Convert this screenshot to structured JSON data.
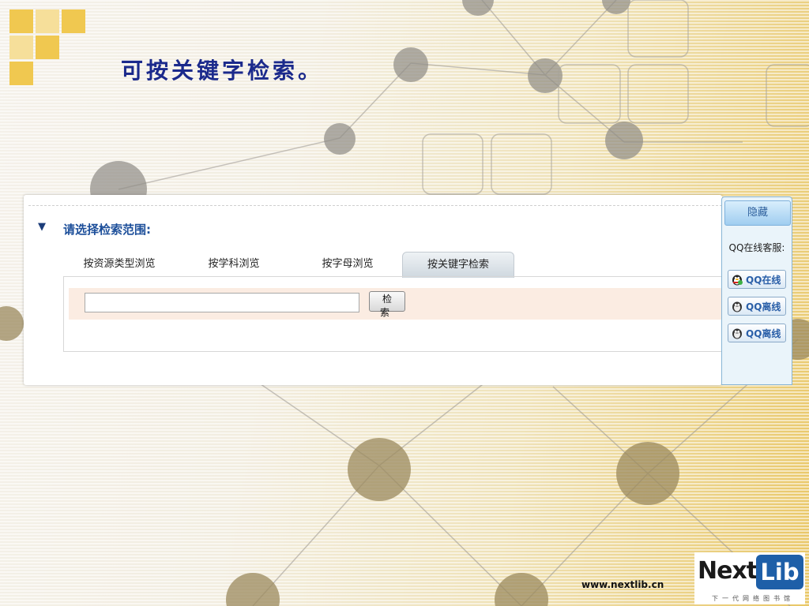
{
  "slide": {
    "title": "可按关键字检索。"
  },
  "panel": {
    "scope_label": "请选择检索范围:",
    "tabs": [
      {
        "label": "按资源类型浏览"
      },
      {
        "label": "按学科浏览"
      },
      {
        "label": "按字母浏览"
      },
      {
        "label": "按关键字检索",
        "active": true
      }
    ],
    "search": {
      "value": "",
      "button_label": "检 索"
    }
  },
  "qq_widget": {
    "hide_label": "隐藏",
    "title": "QQ在线客服:",
    "buttons": [
      {
        "label": "QQ在线",
        "status": "online"
      },
      {
        "label": "QQ离线",
        "status": "offline"
      },
      {
        "label": "QQ离线",
        "status": "offline"
      }
    ]
  },
  "footer": {
    "url": "www.nextlib.cn",
    "logo_next": "Next",
    "logo_lib": "Lib",
    "logo_sub": "下一代网络图书馆"
  },
  "colors": {
    "title": "#1b2a8c",
    "accent_square": "#f0c850",
    "lib_blue": "#1e5fa8"
  }
}
